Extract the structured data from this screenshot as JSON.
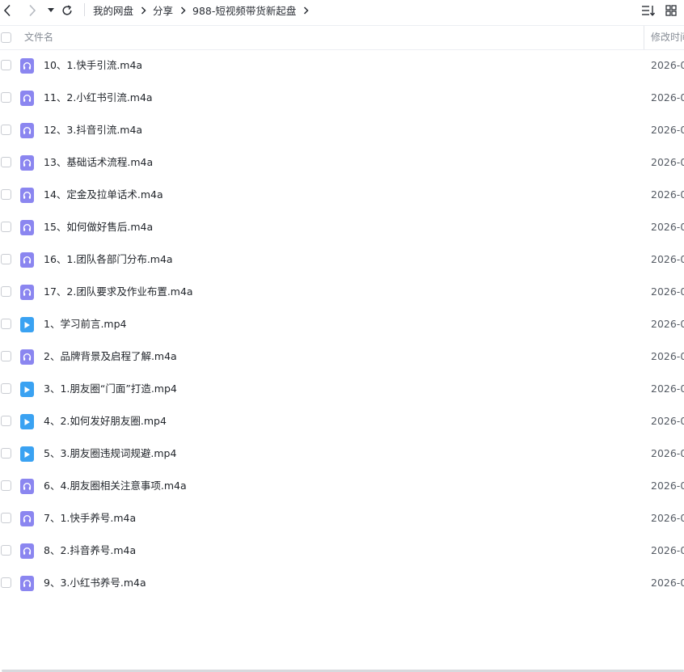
{
  "toolbar": {
    "icons": {
      "back": "chevron-left-icon",
      "forward": "chevron-right-icon",
      "history": "caret-down-icon",
      "refresh": "refresh-icon",
      "sort": "sort-icon",
      "view": "grid-view-icon"
    }
  },
  "breadcrumb": {
    "items": [
      "我的网盘",
      "分享",
      "988-短视频带货新起盘"
    ]
  },
  "header": {
    "name_label": "文件名",
    "date_label": "修改时间"
  },
  "files": [
    {
      "name": "10、1.快手引流.m4a",
      "type": "audio",
      "date": "2026-0"
    },
    {
      "name": "11、2.小红书引流.m4a",
      "type": "audio",
      "date": "2026-0"
    },
    {
      "name": "12、3.抖音引流.m4a",
      "type": "audio",
      "date": "2026-0"
    },
    {
      "name": "13、基础话术流程.m4a",
      "type": "audio",
      "date": "2026-0"
    },
    {
      "name": "14、定金及拉单话术.m4a",
      "type": "audio",
      "date": "2026-0"
    },
    {
      "name": "15、如何做好售后.m4a",
      "type": "audio",
      "date": "2026-0"
    },
    {
      "name": "16、1.团队各部门分布.m4a",
      "type": "audio",
      "date": "2026-0"
    },
    {
      "name": "17、2.团队要求及作业布置.m4a",
      "type": "audio",
      "date": "2026-0"
    },
    {
      "name": "1、学习前言.mp4",
      "type": "video",
      "date": "2026-0"
    },
    {
      "name": "2、品牌背景及启程了解.m4a",
      "type": "audio",
      "date": "2026-0"
    },
    {
      "name": "3、1.朋友圈“门面”打造.mp4",
      "type": "video",
      "date": "2026-0"
    },
    {
      "name": "4、2.如何发好朋友圈.mp4",
      "type": "video",
      "date": "2026-0"
    },
    {
      "name": "5、3.朋友圈违规词规避.mp4",
      "type": "video",
      "date": "2026-0"
    },
    {
      "name": "6、4.朋友圈相关注意事项.m4a",
      "type": "audio",
      "date": "2026-0"
    },
    {
      "name": "7、1.快手养号.m4a",
      "type": "audio",
      "date": "2026-0"
    },
    {
      "name": "8、2.抖音养号.m4a",
      "type": "audio",
      "date": "2026-0"
    },
    {
      "name": "9、3.小红书养号.m4a",
      "type": "audio",
      "date": "2026-0"
    }
  ],
  "colors": {
    "audio_icon": "#8b86f0",
    "video_icon": "#3aa2f2"
  }
}
